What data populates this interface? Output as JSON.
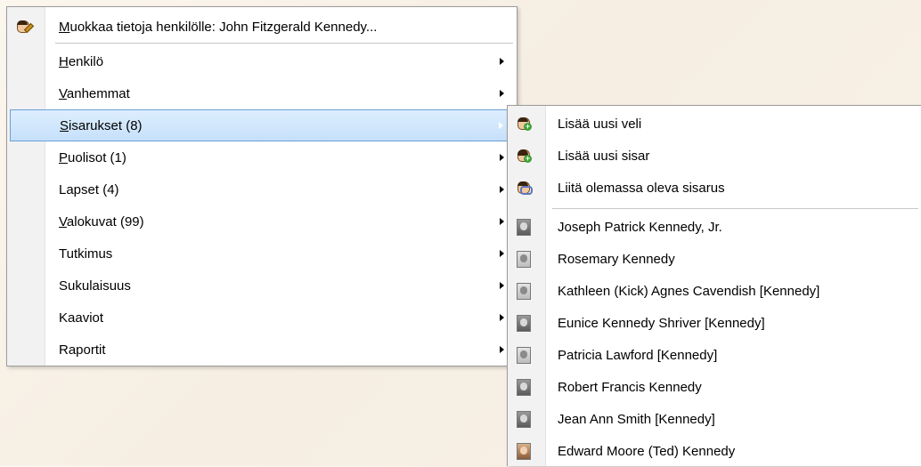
{
  "main_menu": {
    "header_item": {
      "label": "Muokkaa tietoja henkilölle: John Fitzgerald Kennedy...",
      "icon": "edit-person-icon"
    },
    "items": [
      {
        "label": "Henkilö",
        "has_submenu": true
      },
      {
        "label": "Vanhemmat",
        "has_submenu": true
      },
      {
        "label": "Sisarukset (8)",
        "has_submenu": true,
        "highlighted": true
      },
      {
        "label": "Puolisot (1)",
        "has_submenu": true
      },
      {
        "label": "Lapset (4)",
        "has_submenu": true
      },
      {
        "label": "Valokuvat (99)",
        "has_submenu": true
      },
      {
        "label": "Tutkimus",
        "has_submenu": true
      },
      {
        "label": "Sukulaisuus",
        "has_submenu": true
      },
      {
        "label": "Kaaviot",
        "has_submenu": true
      },
      {
        "label": "Raportit",
        "has_submenu": true
      }
    ]
  },
  "sub_menu": {
    "actions": [
      {
        "label": "Lisää uusi veli",
        "icon": "add-brother-icon"
      },
      {
        "label": "Lisää uusi sisar",
        "icon": "add-sister-icon"
      },
      {
        "label": "Liitä olemassa oleva sisarus",
        "icon": "link-sibling-icon"
      }
    ],
    "siblings": [
      {
        "label": "Joseph Patrick Kennedy, Jr.",
        "icon": "portrait-icon"
      },
      {
        "label": "Rosemary Kennedy",
        "icon": "portrait-icon"
      },
      {
        "label": "Kathleen (Kick) Agnes Cavendish [Kennedy]",
        "icon": "portrait-icon"
      },
      {
        "label": "Eunice Kennedy Shriver [Kennedy]",
        "icon": "portrait-icon"
      },
      {
        "label": "Patricia Lawford [Kennedy]",
        "icon": "portrait-icon"
      },
      {
        "label": "Robert Francis Kennedy",
        "icon": "portrait-icon"
      },
      {
        "label": "Jean Ann Smith [Kennedy]",
        "icon": "portrait-icon"
      },
      {
        "label": "Edward Moore (Ted) Kennedy",
        "icon": "portrait-icon"
      }
    ]
  },
  "colors": {
    "highlight_border": "#6a9fd8",
    "highlight_fill": "#c6e0fb",
    "menu_border": "#9c9c9c"
  }
}
